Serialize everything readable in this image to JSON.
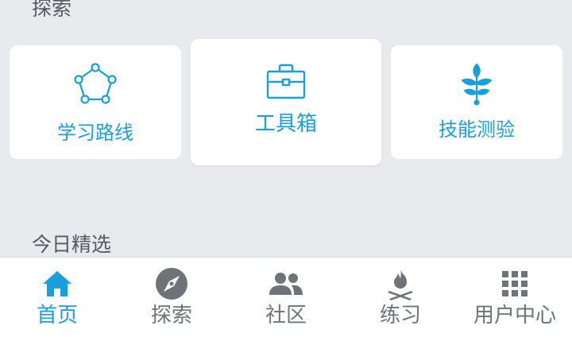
{
  "sections": {
    "explore": "探索",
    "todays_picks": "今日精选"
  },
  "cards": [
    {
      "label": "学习路线",
      "icon": "pentagon-network-icon"
    },
    {
      "label": "工具箱",
      "icon": "briefcase-icon"
    },
    {
      "label": "技能测验",
      "icon": "sprout-icon"
    }
  ],
  "tabs": [
    {
      "label": "首页",
      "icon": "home-icon",
      "active": true
    },
    {
      "label": "探索",
      "icon": "compass-icon",
      "active": false
    },
    {
      "label": "社区",
      "icon": "people-icon",
      "active": false
    },
    {
      "label": "练习",
      "icon": "campfire-icon",
      "active": false
    },
    {
      "label": "用户中心",
      "icon": "grid-icon",
      "active": false
    }
  ],
  "colors": {
    "accent": "#1a9fdc",
    "inactive_icon": "#6e7378",
    "background": "#e8eaee"
  }
}
